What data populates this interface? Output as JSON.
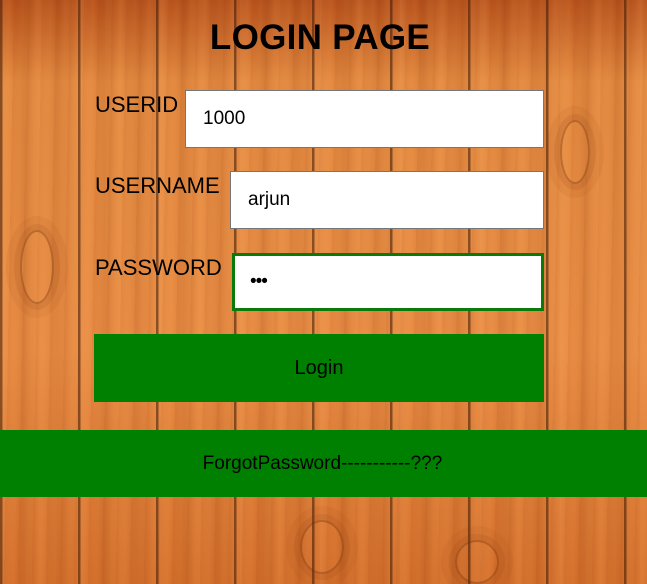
{
  "page": {
    "title": "LOGIN PAGE"
  },
  "form": {
    "userid": {
      "label": "USERID",
      "value": "1000"
    },
    "username": {
      "label": "USERNAME",
      "value": "arjun"
    },
    "password": {
      "label": "PASSWORD",
      "masked_value": "•••"
    },
    "login_label": "Login",
    "forgot_label": "ForgotPassword-----------???"
  },
  "colors": {
    "button_green": "#008000",
    "focus_border": "#0a7a0a",
    "text": "#000000",
    "wood": "#e0833a"
  }
}
